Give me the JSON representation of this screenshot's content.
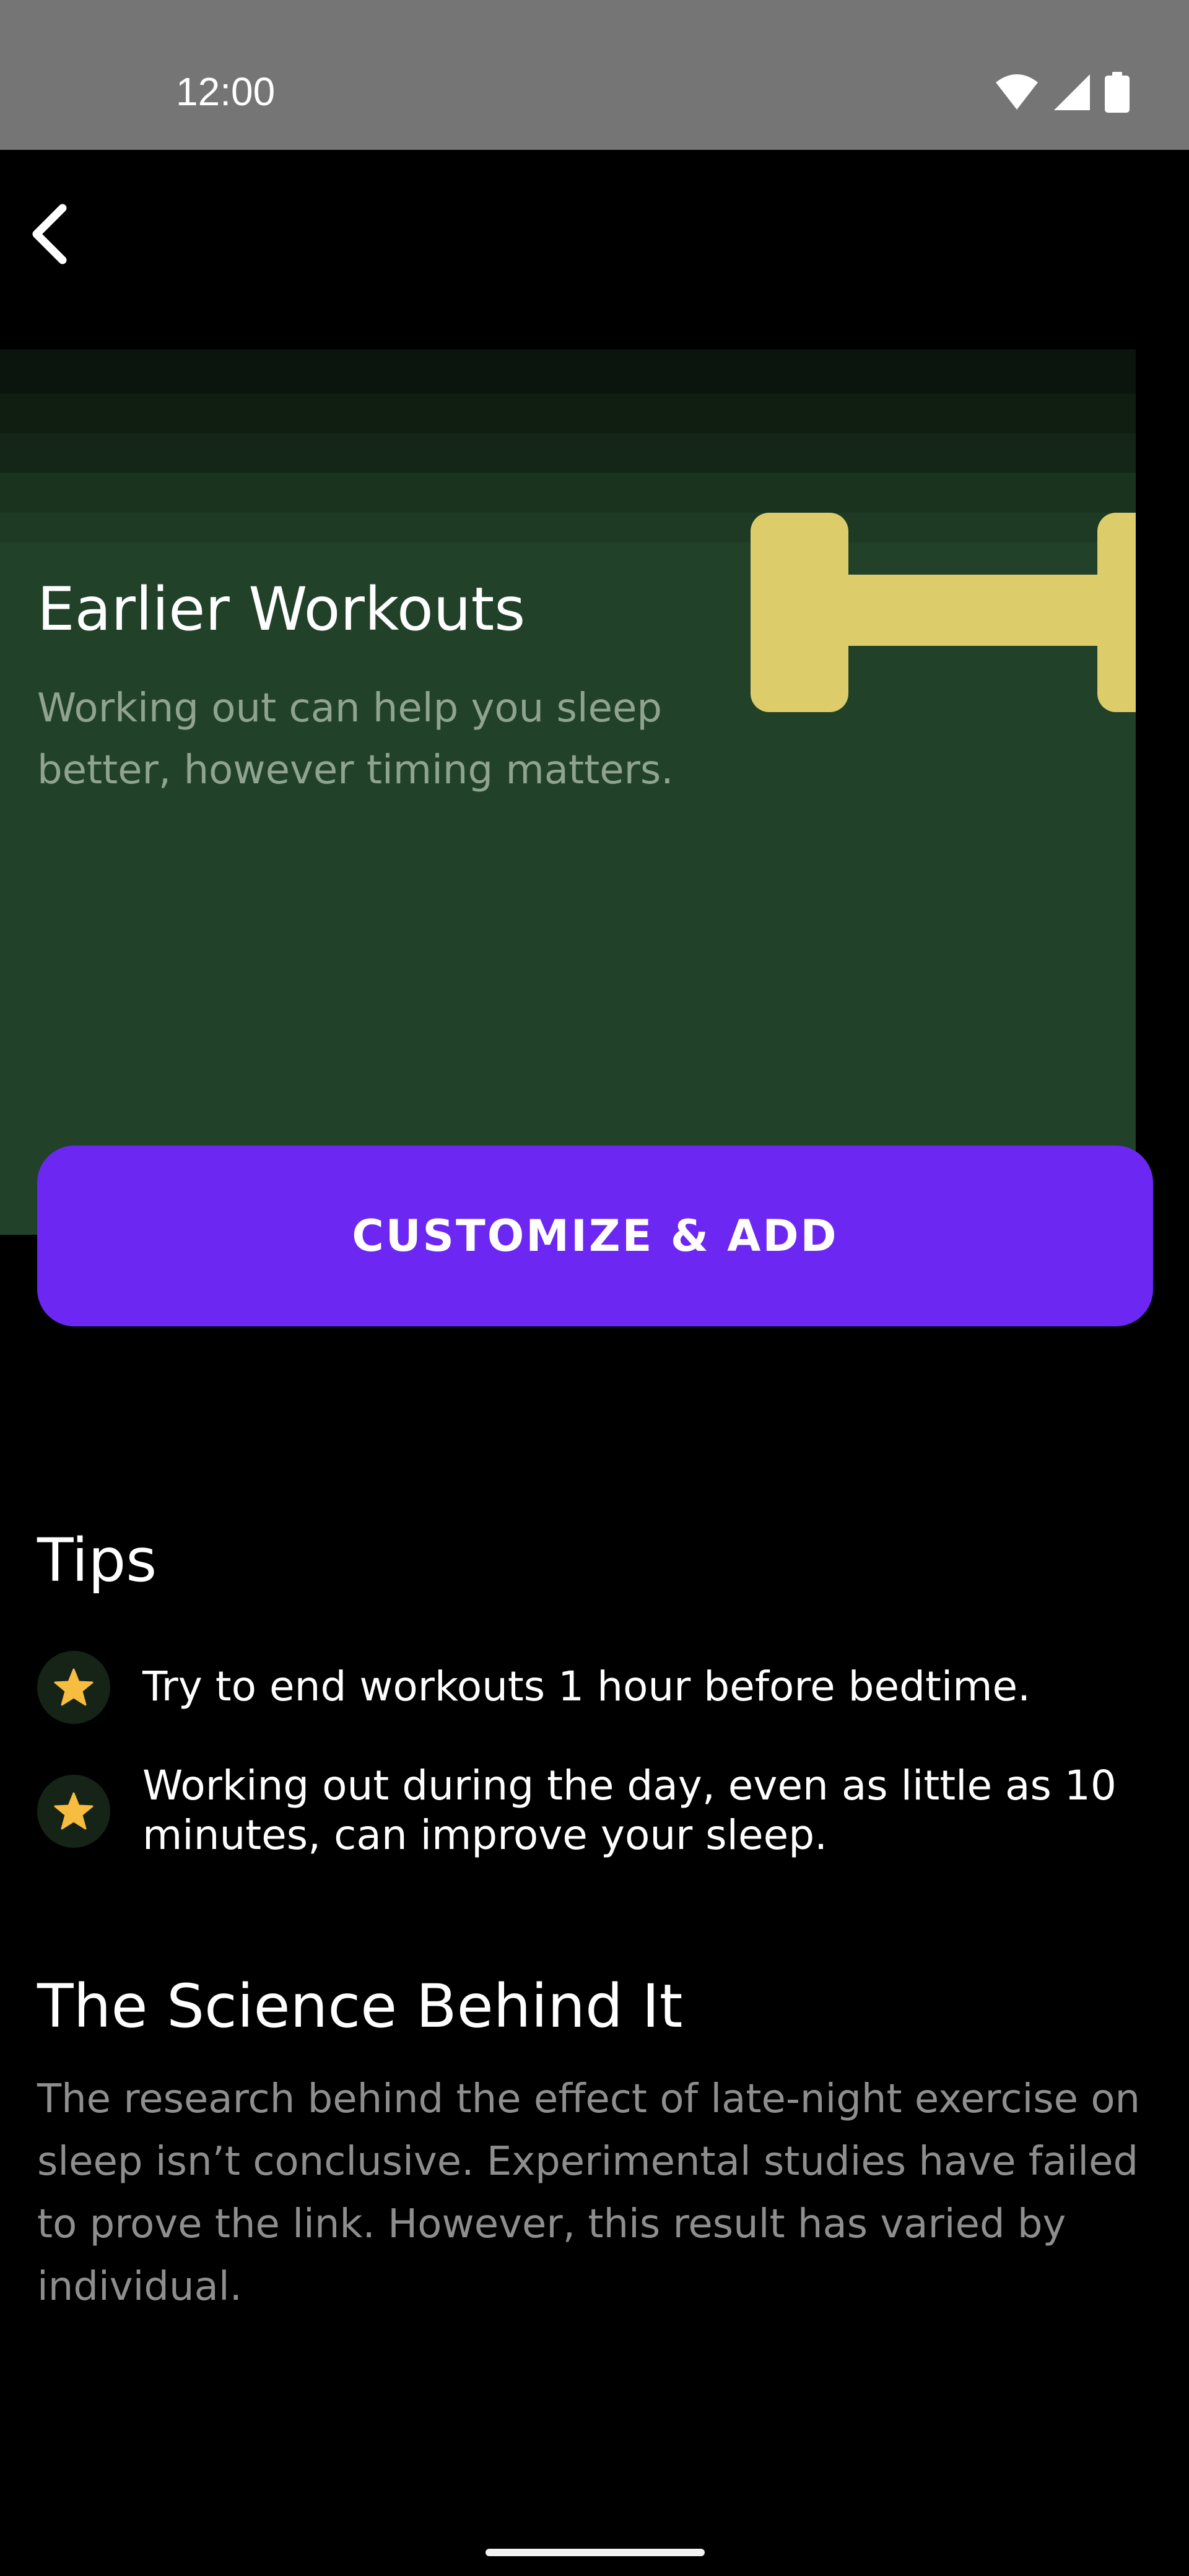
{
  "status_bar": {
    "time": "12:00",
    "icons": [
      "wifi-icon",
      "signal-icon",
      "battery-icon"
    ]
  },
  "navigation": {
    "back_icon": "chevron-left-icon"
  },
  "hero": {
    "title": "Earlier Workouts",
    "description": "Working out can help you sleep better, however timing matters.",
    "illustration": "dumbbell-icon",
    "background_color": "#214229",
    "accent_color": "#dccd6a"
  },
  "cta": {
    "label": "CUSTOMIZE & ADD",
    "color": "#6c28f2"
  },
  "tips": {
    "heading": "Tips",
    "icon": "star-icon",
    "items": [
      {
        "text": "Try to end workouts 1 hour before bedtime."
      },
      {
        "text": "Working out during the day, even as little as 10 minutes, can improve your sleep."
      }
    ]
  },
  "science": {
    "heading": "The Science Behind It",
    "body": "The research behind the effect of late-night exercise on sleep isn’t conclusive. Experimental studies have failed to prove the link. However, this result has varied by individual."
  }
}
